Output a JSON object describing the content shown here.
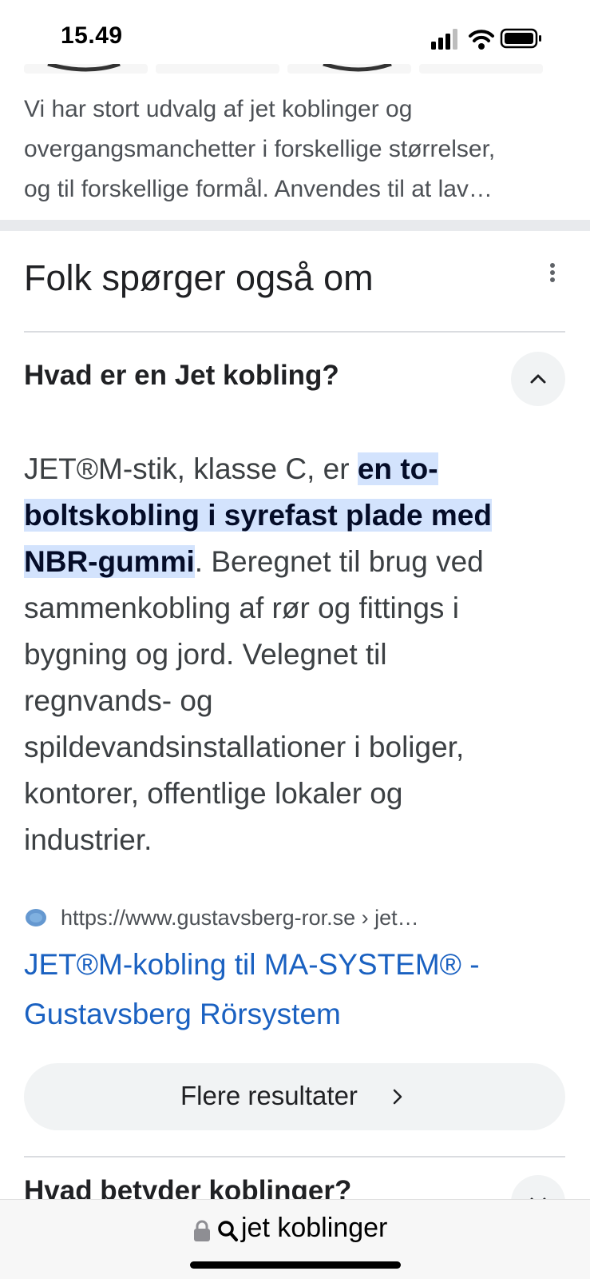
{
  "status_bar": {
    "time": "15.49"
  },
  "snippet": {
    "lines": [
      "Vi har stort udvalg af jet koblinger og",
      "overgangsmanchetter i forskellige størrelser,",
      "og til forskellige formål. Anvendes til at lav…"
    ]
  },
  "paa": {
    "title": "Folk spørger også om",
    "question": "Hvad er en Jet kobling?",
    "answer": {
      "line1_plain": "JET®M-stik, klasse C, er ",
      "line1_highlight": "en to-",
      "line2_highlight": "boltskobling i syrefast plade med",
      "line3_highlight": "NBR-gummi",
      "line3_plain": ". Beregnet til brug ved",
      "line4": "sammenkobling af rør og fittings i",
      "line5": "bygning og jord. Velegnet til",
      "line6": "regnvands- og",
      "line7": "spildevandsinstallationer i boliger,",
      "line8": "kontorer, offentlige lokaler og",
      "line9": "industrier."
    },
    "source_url": "https://www.gustavsberg-ror.se › jet…",
    "result_title_line1": "JET®M-kobling til MA-SYSTEM® -",
    "result_title_line2": "Gustavsberg Rörsystem",
    "more_results_label": "Flere resultater",
    "next_question": "Hvad betyder koblinger?"
  },
  "address_bar": {
    "text": "jet koblinger"
  },
  "colors": {
    "highlight": "#d3e3fd",
    "link": "#1a61c1",
    "divider": "#e8eaed",
    "chip_bg": "#f1f3f4"
  },
  "icons": [
    "signal-icon",
    "wifi-icon",
    "battery-icon",
    "more-vert-icon",
    "chevron-up-icon",
    "chevron-right-icon",
    "chevron-down-icon",
    "lock-icon",
    "search-icon",
    "favicon-icon"
  ]
}
